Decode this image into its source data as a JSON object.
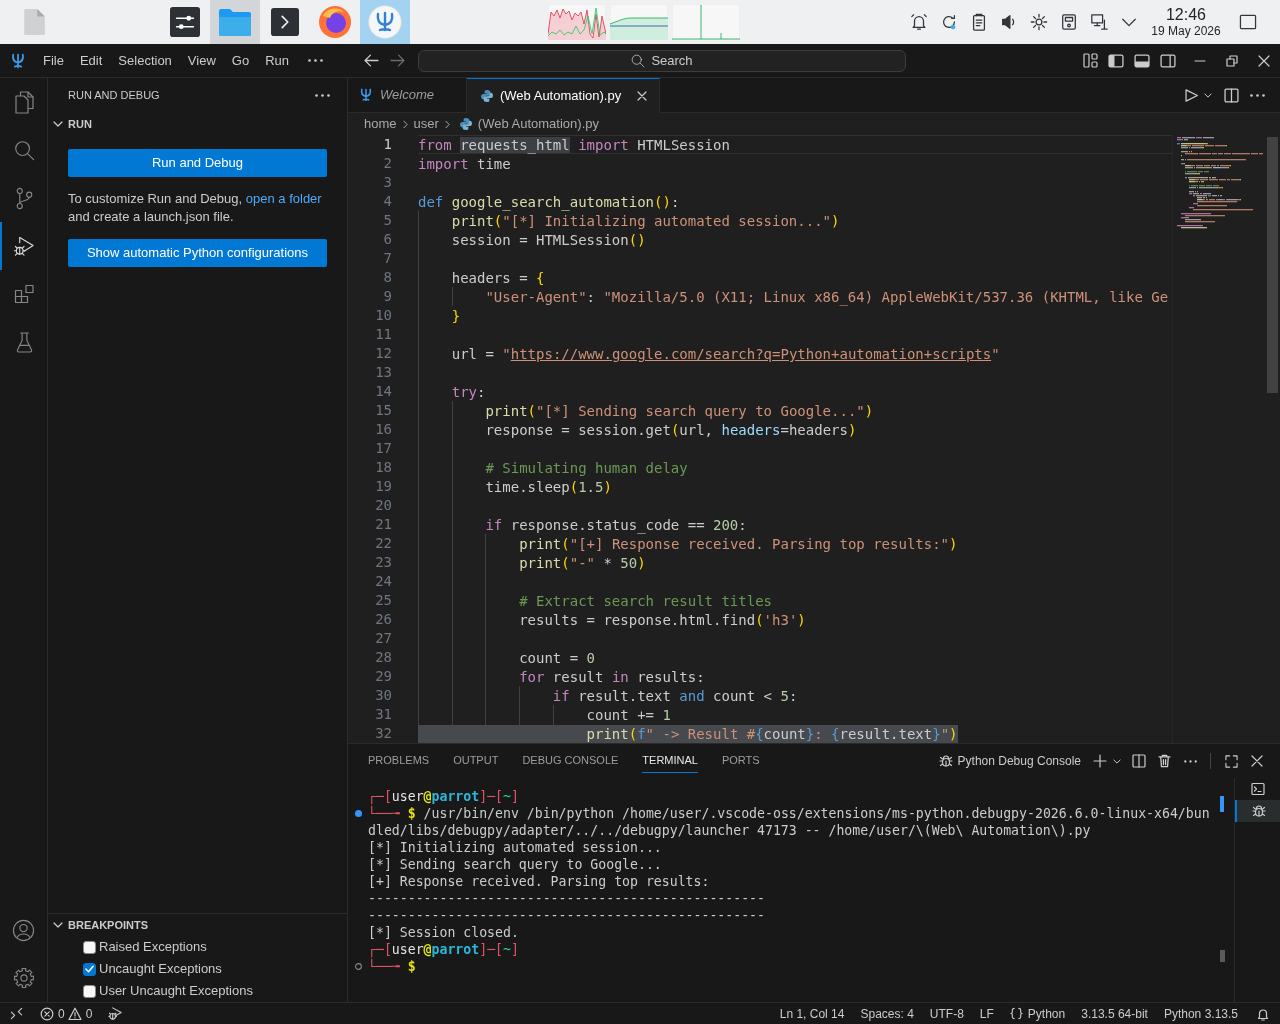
{
  "taskbar": {
    "apps": [
      {
        "kind": "settings",
        "selected": false,
        "highlighted": false
      },
      {
        "kind": "files",
        "selected": false,
        "highlighted": true
      },
      {
        "kind": "terminal",
        "selected": false,
        "highlighted": false
      },
      {
        "kind": "browser",
        "selected": false,
        "highlighted": false
      },
      {
        "kind": "editor",
        "selected": true,
        "highlighted": false
      }
    ],
    "clock": {
      "time": "12:46",
      "date": "19 May 2026"
    }
  },
  "window": {
    "menu": [
      "File",
      "Edit",
      "Selection",
      "View",
      "Go",
      "Run"
    ],
    "command_center": {
      "label": "Search"
    },
    "layout_toggles": [
      {
        "kind": "primary_sidebar",
        "on": true
      },
      {
        "kind": "panel",
        "on": true
      },
      {
        "kind": "secondary_sidebar",
        "on": false
      }
    ]
  },
  "activity_bar": {
    "items": [
      {
        "kind": "explorer",
        "selected": false
      },
      {
        "kind": "search",
        "selected": false
      },
      {
        "kind": "source_control",
        "selected": false
      },
      {
        "kind": "run_debug",
        "selected": true
      },
      {
        "kind": "extensions",
        "selected": false
      },
      {
        "kind": "testing",
        "selected": false
      }
    ]
  },
  "sidebar": {
    "title": "RUN AND DEBUG",
    "run_section": {
      "title": "RUN",
      "expanded": true,
      "primary_button": "Run and Debug",
      "hint": {
        "before": "To customize Run and Debug,",
        "link": "open a folder",
        "after": "and create a launch.json file."
      },
      "secondary_button": "Show automatic Python configurations"
    },
    "breakpoints": {
      "title": "BREAKPOINTS",
      "expanded": true,
      "items": [
        {
          "label": "Raised Exceptions",
          "checked": false
        },
        {
          "label": "Uncaught Exceptions",
          "checked": true
        },
        {
          "label": "User Uncaught Exceptions",
          "checked": false
        }
      ]
    }
  },
  "editor": {
    "tabs": [
      {
        "label": "Welcome",
        "kind": "welcome",
        "selected": false,
        "preview": true
      },
      {
        "label": "(Web Automation).py",
        "kind": "python",
        "selected": true,
        "preview": false
      }
    ],
    "breadcrumbs": [
      {
        "text": "home",
        "kind": "folder"
      },
      {
        "text": "user",
        "kind": "folder"
      },
      {
        "text": "(Web Automation).py",
        "kind": "python_file"
      }
    ],
    "lines": [
      {
        "number": "1",
        "current": true,
        "selected": false,
        "tokens": [
          {
            "text": "from ",
            "kind": "control"
          },
          {
            "text": "requests_html",
            "kind": "match"
          },
          {
            "text": " import ",
            "kind": "control"
          },
          {
            "text": "HTMLSession",
            "kind": "plain"
          }
        ]
      },
      {
        "number": "2",
        "current": false,
        "selected": false,
        "tokens": [
          {
            "text": "import ",
            "kind": "control"
          },
          {
            "text": "time",
            "kind": "plain"
          }
        ]
      },
      {
        "number": "3",
        "current": false
      },
      {
        "number": "4",
        "current": false,
        "selected": false,
        "tokens": [
          {
            "text": "def ",
            "kind": "keyword"
          },
          {
            "text": "google_search_automation",
            "kind": "function"
          },
          {
            "text": "()",
            "kind": "bracket"
          },
          {
            "text": ":",
            "kind": "plain"
          }
        ]
      },
      {
        "number": "5",
        "current": false,
        "selected": false,
        "tokens": [
          {
            "text": "    print",
            "kind": "function"
          },
          {
            "text": "(",
            "kind": "bracket"
          },
          {
            "text": "\"[*] Initializing automated session...\"",
            "kind": "string"
          },
          {
            "text": ")",
            "kind": "bracket"
          }
        ]
      },
      {
        "number": "6",
        "current": false,
        "selected": false,
        "tokens": [
          {
            "text": "    session = HTMLSession",
            "kind": "plain"
          },
          {
            "text": "()",
            "kind": "bracket"
          }
        ]
      },
      {
        "number": "7",
        "current": false
      },
      {
        "number": "8",
        "current": false,
        "selected": false,
        "tokens": [
          {
            "text": "    headers = ",
            "kind": "plain"
          },
          {
            "text": "{",
            "kind": "bracket"
          }
        ]
      },
      {
        "number": "9",
        "current": false,
        "selected": false,
        "tokens": [
          {
            "text": "        \"User-Agent\"",
            "kind": "string"
          },
          {
            "text": ": ",
            "kind": "plain"
          },
          {
            "text": "\"Mozilla/5.0 (X11; Linux x86_64) AppleWebKit/537.36 (KHTML, like Ge",
            "kind": "string"
          }
        ]
      },
      {
        "number": "10",
        "current": false,
        "selected": false,
        "tokens": [
          {
            "text": "    }",
            "kind": "bracket"
          }
        ]
      },
      {
        "number": "11",
        "current": false
      },
      {
        "number": "12",
        "current": false,
        "selected": false,
        "tokens": [
          {
            "text": "    url = ",
            "kind": "plain"
          },
          {
            "text": "\"",
            "kind": "string"
          },
          {
            "text": "https://www.google.com/search?q=Python+automation+scripts",
            "kind": "link"
          },
          {
            "text": "\"",
            "kind": "string"
          }
        ]
      },
      {
        "number": "13",
        "current": false
      },
      {
        "number": "14",
        "current": false,
        "selected": false,
        "tokens": [
          {
            "text": "    try",
            "kind": "control"
          },
          {
            "text": ":",
            "kind": "plain"
          }
        ]
      },
      {
        "number": "15",
        "current": false,
        "selected": false,
        "tokens": [
          {
            "text": "        print",
            "kind": "function"
          },
          {
            "text": "(",
            "kind": "bracket"
          },
          {
            "text": "\"[*] Sending search query to Google...\"",
            "kind": "string"
          },
          {
            "text": ")",
            "kind": "bracket"
          }
        ]
      },
      {
        "number": "16",
        "current": false,
        "selected": false,
        "tokens": [
          {
            "text": "        response = session.get",
            "kind": "plain"
          },
          {
            "text": "(",
            "kind": "bracket"
          },
          {
            "text": "url, ",
            "kind": "plain"
          },
          {
            "text": "headers",
            "kind": "param"
          },
          {
            "text": "=headers",
            "kind": "plain"
          },
          {
            "text": ")",
            "kind": "bracket"
          }
        ]
      },
      {
        "number": "17",
        "current": false
      },
      {
        "number": "18",
        "current": false,
        "selected": false,
        "tokens": [
          {
            "text": "        # Simulating human delay",
            "kind": "comment"
          }
        ]
      },
      {
        "number": "19",
        "current": false,
        "selected": false,
        "tokens": [
          {
            "text": "        time.sleep",
            "kind": "plain"
          },
          {
            "text": "(",
            "kind": "bracket"
          },
          {
            "text": "1.5",
            "kind": "number"
          },
          {
            "text": ")",
            "kind": "bracket"
          }
        ]
      },
      {
        "number": "20",
        "current": false
      },
      {
        "number": "21",
        "current": false,
        "selected": false,
        "tokens": [
          {
            "text": "        if",
            "kind": "control"
          },
          {
            "text": " response.status_code == ",
            "kind": "plain"
          },
          {
            "text": "200",
            "kind": "number"
          },
          {
            "text": ":",
            "kind": "plain"
          }
        ]
      },
      {
        "number": "22",
        "current": false,
        "selected": false,
        "tokens": [
          {
            "text": "            print",
            "kind": "function"
          },
          {
            "text": "(",
            "kind": "bracket"
          },
          {
            "text": "\"[+] Response received. Parsing top results:\"",
            "kind": "string"
          },
          {
            "text": ")",
            "kind": "bracket"
          }
        ]
      },
      {
        "number": "23",
        "current": false,
        "selected": false,
        "tokens": [
          {
            "text": "            print",
            "kind": "function"
          },
          {
            "text": "(",
            "kind": "bracket"
          },
          {
            "text": "\"-\"",
            "kind": "string"
          },
          {
            "text": " * ",
            "kind": "plain"
          },
          {
            "text": "50",
            "kind": "number"
          },
          {
            "text": ")",
            "kind": "bracket"
          }
        ]
      },
      {
        "number": "24",
        "current": false
      },
      {
        "number": "25",
        "current": false,
        "selected": false,
        "tokens": [
          {
            "text": "            # Extract search result titles",
            "kind": "comment"
          }
        ]
      },
      {
        "number": "26",
        "current": false,
        "selected": false,
        "tokens": [
          {
            "text": "            results = response.html.find",
            "kind": "plain"
          },
          {
            "text": "(",
            "kind": "bracket"
          },
          {
            "text": "'h3'",
            "kind": "string"
          },
          {
            "text": ")",
            "kind": "bracket"
          }
        ]
      },
      {
        "number": "27",
        "current": false
      },
      {
        "number": "28",
        "current": false,
        "selected": false,
        "tokens": [
          {
            "text": "            count = ",
            "kind": "plain"
          },
          {
            "text": "0",
            "kind": "number"
          }
        ]
      },
      {
        "number": "29",
        "current": false,
        "selected": false,
        "tokens": [
          {
            "text": "            for",
            "kind": "control"
          },
          {
            "text": " result ",
            "kind": "plain"
          },
          {
            "text": "in",
            "kind": "control"
          },
          {
            "text": " results:",
            "kind": "plain"
          }
        ]
      },
      {
        "number": "30",
        "current": false,
        "selected": false,
        "tokens": [
          {
            "text": "                if",
            "kind": "control"
          },
          {
            "text": " result.text ",
            "kind": "plain"
          },
          {
            "text": "and",
            "kind": "keyword"
          },
          {
            "text": " count < ",
            "kind": "plain"
          },
          {
            "text": "5",
            "kind": "number"
          },
          {
            "text": ":",
            "kind": "plain"
          }
        ]
      },
      {
        "number": "31",
        "current": false,
        "selected": false,
        "tokens": [
          {
            "text": "                    count += ",
            "kind": "plain"
          },
          {
            "text": "1",
            "kind": "number"
          }
        ]
      },
      {
        "number": "32",
        "current": false,
        "selected": true,
        "tokens": [
          {
            "text": "                    print",
            "kind": "function"
          },
          {
            "text": "(",
            "kind": "bracket"
          },
          {
            "text": "f",
            "kind": "keyword"
          },
          {
            "text": "\" -> Result #",
            "kind": "string"
          },
          {
            "text": "{",
            "kind": "fbrace"
          },
          {
            "text": "count",
            "kind": "plain"
          },
          {
            "text": "}",
            "kind": "fbrace"
          },
          {
            "text": ": ",
            "kind": "string"
          },
          {
            "text": "{",
            "kind": "fbrace"
          },
          {
            "text": "result.text",
            "kind": "plain"
          },
          {
            "text": "}",
            "kind": "fbrace"
          },
          {
            "text": "\"",
            "kind": "string"
          },
          {
            "text": ")",
            "kind": "bracket"
          }
        ]
      }
    ]
  },
  "panel": {
    "tabs": [
      {
        "label": "PROBLEMS",
        "selected": false
      },
      {
        "label": "OUTPUT",
        "selected": false
      },
      {
        "label": "DEBUG CONSOLE",
        "selected": false
      },
      {
        "label": "TERMINAL",
        "selected": true
      },
      {
        "label": "PORTS",
        "selected": false
      }
    ],
    "terminal_name": "Python Debug Console",
    "terminal_lines": [
      {
        "kind": "output",
        "segments": [
          {
            "text": "┌─[",
            "kind": "frame"
          },
          {
            "text": "user",
            "kind": "user"
          },
          {
            "text": "@",
            "kind": "at"
          },
          {
            "text": "parrot",
            "kind": "host"
          },
          {
            "text": "]─[",
            "kind": "frame"
          },
          {
            "text": "~",
            "kind": "dir"
          },
          {
            "text": "]",
            "kind": "frame"
          }
        ]
      },
      {
        "kind": "command",
        "finished": true,
        "segments": [
          {
            "text": "└──╼ ",
            "kind": "frame"
          },
          {
            "text": "$",
            "kind": "dollar"
          },
          {
            "text": " /usr/bin/env /bin/python /home/user/.vscode-oss/extensions/ms-python.debugpy-2026.6.0-linux-x64/bun",
            "kind": "text"
          }
        ]
      },
      {
        "kind": "output",
        "segments": [
          {
            "text": "dled/libs/debugpy/adapter/../../debugpy/launcher 47173 -- /home/user/\\(Web\\ Automation\\).py",
            "kind": "text"
          }
        ]
      },
      {
        "kind": "output",
        "segments": [
          {
            "text": "[*] Initializing automated session...",
            "kind": "text"
          }
        ]
      },
      {
        "kind": "output",
        "segments": [
          {
            "text": "[*] Sending search query to Google...",
            "kind": "text"
          }
        ]
      },
      {
        "kind": "output",
        "segments": [
          {
            "text": "[+] Response received. Parsing top results:",
            "kind": "text"
          }
        ]
      },
      {
        "kind": "output",
        "segments": [
          {
            "text": "--------------------------------------------------",
            "kind": "text"
          }
        ]
      },
      {
        "kind": "output",
        "segments": [
          {
            "text": "--------------------------------------------------",
            "kind": "text"
          }
        ]
      },
      {
        "kind": "output",
        "segments": [
          {
            "text": "[*] Session closed.",
            "kind": "text"
          }
        ]
      },
      {
        "kind": "output",
        "segments": [
          {
            "text": "┌─[",
            "kind": "frame"
          },
          {
            "text": "user",
            "kind": "user"
          },
          {
            "text": "@",
            "kind": "at"
          },
          {
            "text": "parrot",
            "kind": "host"
          },
          {
            "text": "]─[",
            "kind": "frame"
          },
          {
            "text": "~",
            "kind": "dir"
          },
          {
            "text": "]",
            "kind": "frame"
          }
        ]
      },
      {
        "kind": "command",
        "finished": false,
        "segments": [
          {
            "text": "└──╼ ",
            "kind": "frame"
          },
          {
            "text": "$",
            "kind": "dollar"
          }
        ]
      }
    ],
    "terminals": [
      {
        "kind": "shell",
        "selected": false
      },
      {
        "kind": "debug",
        "selected": true
      }
    ]
  },
  "status_bar": {
    "errors": "0",
    "warnings": "0",
    "items": [
      {
        "text": "Ln 1, Col 14",
        "kind": "plain"
      },
      {
        "text": "Spaces: 4",
        "kind": "plain"
      },
      {
        "text": "UTF-8",
        "kind": "plain"
      },
      {
        "text": "LF",
        "kind": "plain"
      },
      {
        "text": "Python",
        "kind": "language"
      },
      {
        "text": "3.13.5 64-bit",
        "kind": "plain"
      },
      {
        "text": "Python 3.13.5",
        "kind": "plain"
      }
    ]
  }
}
